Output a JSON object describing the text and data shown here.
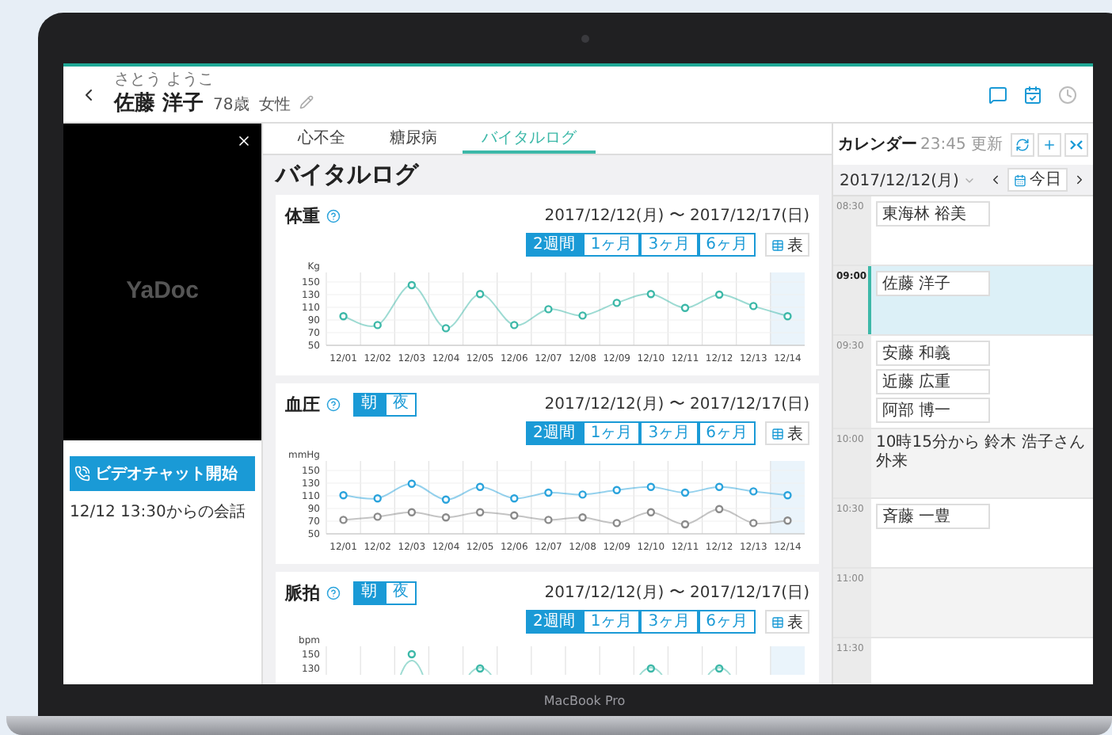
{
  "header": {
    "furigana": "さとう ようこ",
    "name": "佐藤 洋子",
    "age": "78歳",
    "sex": "女性"
  },
  "video_panel": {
    "logo": "YaDoc",
    "start_button": "ビデオチャット開始",
    "conversation": "12/12 13:30からの会話"
  },
  "tabs": [
    {
      "label": "心不全",
      "selected": false
    },
    {
      "label": "糖尿病",
      "selected": false
    },
    {
      "label": "バイタルログ",
      "selected": true
    }
  ],
  "page_title": "バイタルログ",
  "vital_cards": [
    {
      "title": "体重",
      "date_range": "2017/12/12(月) 〜 2017/12/17(日)",
      "ranges": [
        {
          "label": "2週間",
          "selected": true
        },
        {
          "label": "1ヶ月",
          "selected": false
        },
        {
          "label": "3ヶ月",
          "selected": false
        },
        {
          "label": "6ヶ月",
          "selected": false
        }
      ],
      "table_button": "表",
      "chart_data": {
        "type": "line",
        "ylabel": "Kg",
        "grid": true,
        "categories": [
          "12/01",
          "12/02",
          "12/03",
          "12/04",
          "12/05",
          "12/06",
          "12/07",
          "12/08",
          "12/09",
          "12/10",
          "12/11",
          "12/12",
          "12/13",
          "12/14"
        ],
        "ylim": [
          50,
          165
        ],
        "yticks": [
          50,
          70,
          90,
          110,
          130,
          150
        ],
        "series": [
          {
            "color": "#3cb8a8",
            "marker": "o",
            "values": [
              96,
              82,
              145,
              77,
              131,
              82,
              107,
              97,
              117,
              131,
              109,
              130,
              112,
              96
            ]
          }
        ]
      }
    },
    {
      "title": "血圧",
      "time_toggle": [
        {
          "label": "朝",
          "selected": true
        },
        {
          "label": "夜",
          "selected": false
        }
      ],
      "date_range": "2017/12/12(月) 〜 2017/12/17(日)",
      "ranges": [
        {
          "label": "2週間",
          "selected": true
        },
        {
          "label": "1ヶ月",
          "selected": false
        },
        {
          "label": "3ヶ月",
          "selected": false
        },
        {
          "label": "6ヶ月",
          "selected": false
        }
      ],
      "table_button": "表",
      "chart_data": {
        "type": "line",
        "ylabel": "mmHg",
        "grid": true,
        "categories": [
          "12/01",
          "12/02",
          "12/03",
          "12/04",
          "12/05",
          "12/06",
          "12/07",
          "12/08",
          "12/09",
          "12/10",
          "12/11",
          "12/12",
          "12/13",
          "12/14"
        ],
        "ylim": [
          50,
          165
        ],
        "yticks": [
          50,
          70,
          90,
          110,
          130,
          150
        ],
        "series": [
          {
            "color": "#2aa3dc",
            "marker": "o",
            "values": [
              111,
              106,
              129,
              104,
              124,
              106,
              115,
              112,
              119,
              124,
              115,
              124,
              117,
              111
            ]
          },
          {
            "color": "#8a8a8a",
            "marker": "o",
            "values": [
              72,
              77,
              84,
              76,
              84,
              79,
              72,
              76,
              67,
              84,
              65,
              89,
              67,
              71
            ]
          }
        ]
      }
    },
    {
      "title": "脈拍",
      "time_toggle": [
        {
          "label": "朝",
          "selected": true
        },
        {
          "label": "夜",
          "selected": false
        }
      ],
      "date_range": "2017/12/12(月) 〜 2017/12/17(日)",
      "ranges": [
        {
          "label": "2週間",
          "selected": true
        },
        {
          "label": "1ヶ月",
          "selected": false
        },
        {
          "label": "3ヶ月",
          "selected": false
        },
        {
          "label": "6ヶ月",
          "selected": false
        }
      ],
      "table_button": "表",
      "chart_preview": {
        "ylabel": "bpm",
        "yticks": [
          "150",
          "130"
        ]
      }
    }
  ],
  "calendar": {
    "title": "カレンダー",
    "updated": "23:45 更新",
    "date": "2017/12/12(月)",
    "today_button": "今日",
    "slots": [
      {
        "time": "08:30",
        "selected": false,
        "entries": [
          "東海林 裕美"
        ]
      },
      {
        "time": "09:00",
        "selected": true,
        "entries": [
          "佐藤 洋子"
        ]
      },
      {
        "time": "09:30",
        "selected": false,
        "entries": [
          "安藤 和義",
          "近藤 広重",
          "阿部 博一"
        ]
      },
      {
        "time": "10:00",
        "selected": false,
        "note": "10時15分から 鈴木 浩子さん外来"
      },
      {
        "time": "10:30",
        "selected": false,
        "entries": [
          "斉藤 一豊"
        ]
      },
      {
        "time": "11:00",
        "selected": false
      },
      {
        "time": "11:30",
        "selected": false
      }
    ]
  },
  "device": {
    "label": "MacBook Pro"
  }
}
